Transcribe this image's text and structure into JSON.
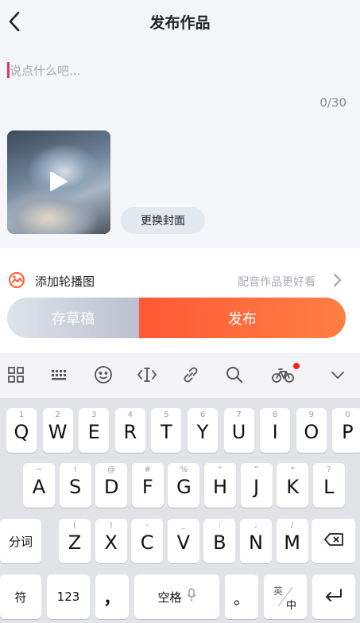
{
  "header": {
    "title": "发布作品",
    "back_icon": "chevron-left-icon"
  },
  "compose": {
    "placeholder": "说点什么吧...",
    "char_count": "0/30",
    "cursor_color": "#e2336b",
    "video_play_icon": "play-icon",
    "change_cover_label": "更换封面"
  },
  "carousel": {
    "label": "添加轮播图",
    "icon": "carousel-icon",
    "hint": "配音作品更好看",
    "chevron_icon": "chevron-right-icon"
  },
  "actions": {
    "draft_label": "存草稿",
    "publish_label": "发布",
    "publish_color": "#ff6a3d"
  },
  "keyboard_toolbar": {
    "items": [
      "grid-icon",
      "keyboard-icon",
      "emoji-icon",
      "text-cursor-icon",
      "link-icon",
      "search-icon",
      "bicycle-icon",
      "collapse-icon"
    ]
  },
  "keyboard": {
    "row1": [
      {
        "hint": "1",
        "key": "Q"
      },
      {
        "hint": "2",
        "key": "W"
      },
      {
        "hint": "3",
        "key": "E"
      },
      {
        "hint": "4",
        "key": "R"
      },
      {
        "hint": "5",
        "key": "T"
      },
      {
        "hint": "6",
        "key": "Y"
      },
      {
        "hint": "7",
        "key": "U"
      },
      {
        "hint": "8",
        "key": "I"
      },
      {
        "hint": "9",
        "key": "O"
      },
      {
        "hint": "0",
        "key": "P"
      }
    ],
    "row2": [
      {
        "hint": "~",
        "key": "A"
      },
      {
        "hint": "!",
        "key": "S"
      },
      {
        "hint": "@",
        "key": "D"
      },
      {
        "hint": "#",
        "key": "F"
      },
      {
        "hint": "%",
        "key": "G"
      },
      {
        "hint": "“",
        "key": "H"
      },
      {
        "hint": "”",
        "key": "J"
      },
      {
        "hint": "*",
        "key": "K"
      },
      {
        "hint": "?",
        "key": "L"
      }
    ],
    "row3": [
      {
        "hint": "(",
        "key": "Z"
      },
      {
        "hint": ")",
        "key": "X"
      },
      {
        "hint": "-",
        "key": "C"
      },
      {
        "hint": "_",
        "key": "V"
      },
      {
        "hint": ":",
        "key": "B"
      },
      {
        "hint": ";",
        "key": "N"
      },
      {
        "hint": "/",
        "key": "M"
      }
    ],
    "fenci_label": "分词",
    "symbol_label": "符",
    "num_label": "123",
    "comma_label": "，",
    "space_label": "空格",
    "period_label": "。",
    "lang_top": "英",
    "lang_bottom": "中"
  }
}
